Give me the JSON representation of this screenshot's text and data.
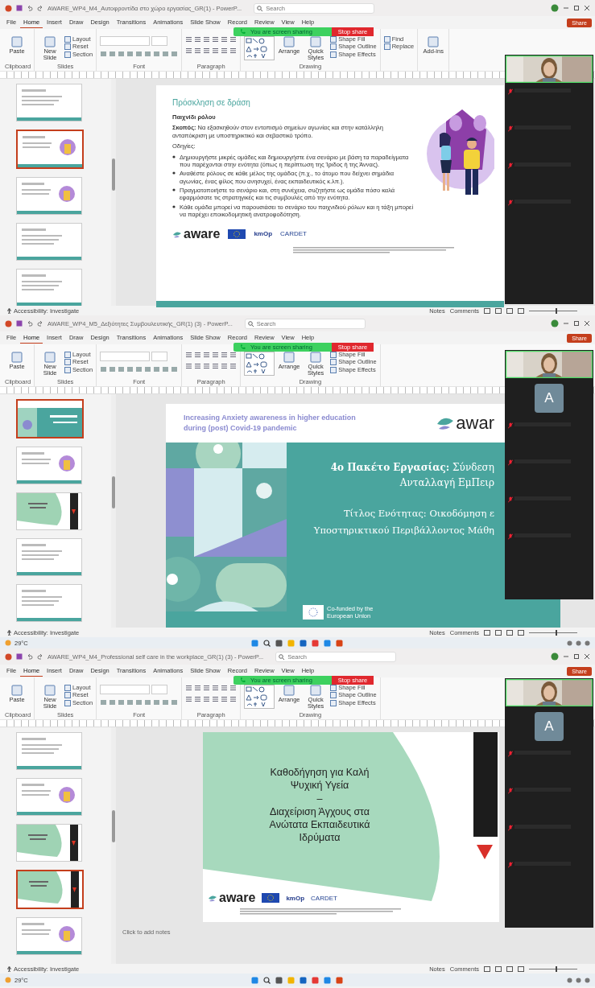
{
  "windows": [
    {
      "title": "AWARE_WP4_M4_Αυτοφροντίδα στο χώρο εργασίας_GR(1) - PowerP...",
      "search": {
        "placeholder": "Search"
      },
      "tabs": [
        {
          "label": "File",
          "selected": false
        },
        {
          "label": "Home",
          "selected": true
        },
        {
          "label": "Insert",
          "selected": false
        },
        {
          "label": "Draw",
          "selected": false
        },
        {
          "label": "Design",
          "selected": false
        },
        {
          "label": "Transitions",
          "selected": false
        },
        {
          "label": "Animations",
          "selected": false
        },
        {
          "label": "Slide Show",
          "selected": false
        },
        {
          "label": "Record",
          "selected": false
        },
        {
          "label": "Review",
          "selected": false
        },
        {
          "label": "View",
          "selected": false
        },
        {
          "label": "Help",
          "selected": false
        }
      ],
      "share_button": "Share",
      "share_banner": {
        "text": "You are screen sharing",
        "stop": "Stop share"
      },
      "ribbon": [
        {
          "label": "Clipboard",
          "items": [
            {
              "kind": "big",
              "label": "Paste"
            }
          ]
        },
        {
          "label": "Slides",
          "items": [
            {
              "kind": "big",
              "label": "New Slide"
            },
            {
              "kind": "small",
              "label": "Layout"
            },
            {
              "kind": "small",
              "label": "Reset"
            },
            {
              "kind": "small",
              "label": "Section"
            }
          ]
        },
        {
          "label": "Font",
          "items": [
            {
              "kind": "font"
            }
          ]
        },
        {
          "label": "Paragraph",
          "items": [
            {
              "kind": "paragraph"
            }
          ]
        },
        {
          "label": "Drawing",
          "items": [
            {
              "kind": "shapes"
            },
            {
              "kind": "big",
              "label": "Arrange"
            },
            {
              "kind": "big",
              "label": "Quick Styles"
            },
            {
              "kind": "small",
              "label": "Shape Fill"
            },
            {
              "kind": "small",
              "label": "Shape Outline"
            },
            {
              "kind": "small",
              "label": "Shape Effects"
            }
          ]
        },
        {
          "items": [
            {
              "kind": "small",
              "label": "Find"
            },
            {
              "kind": "small",
              "label": "Replace"
            }
          ]
        },
        {
          "items": [
            {
              "kind": "big",
              "label": "Add-ins"
            }
          ]
        }
      ],
      "thumbnails": [
        {
          "kind": "text",
          "selected": false
        },
        {
          "kind": "art",
          "selected": true
        },
        {
          "kind": "art",
          "selected": false
        },
        {
          "kind": "text",
          "selected": false
        },
        {
          "kind": "text",
          "selected": false
        }
      ],
      "slide": {
        "kind": "call_to_action",
        "title": "Πρόσκληση σε δράση",
        "subtitle": "Παιχνίδι ρόλου",
        "purpose": "**Σκοπός:** Να εξασκηθούν στον εντοπισμό σημείων αγωνίας και στην κατάλληλη ανταπόκριση με υποστηρικτικό και σεβαστικό τρόπο.",
        "instructions_label": "Οδηγίες:",
        "bullets": [
          "Δημιουργήστε μικρές ομάδες και δημιουργήστε ένα σενάριο με βάση τα παραδείγματα που παρέχονται στην ενότητα (όπως η περίπτωση της Ίριδος ή της Άννας).",
          "Αναθέστε ρόλους σε κάθε μέλος της ομάδας (π.χ., το άτομο που δείχνει σημάδια αγωνίας, ένας φίλος που ανησυχεί, ένας εκπαιδευτικός κ.λπ.).",
          "Πραγματοποιήστε το σενάριο και, στη συνέχεια, συζητήστε ως ομάδα πόσο καλά εφαρμόσατε τις στρατηγικές και τις συμβουλές από την ενότητα.",
          "Κάθε ομάδα μπορεί να παρουσιάσει το σενάριο του παιχνιδιού ρόλων και η τάξη μπορεί να παρέχει εποικοδομητική ανατροφοδότηση."
        ],
        "logos": [
          "aware",
          "kmOp",
          "CARDET"
        ]
      },
      "participants": [
        {
          "kind": "camera"
        },
        {
          "kind": "muted"
        },
        {
          "kind": "muted"
        },
        {
          "kind": "muted"
        },
        {
          "kind": "muted"
        }
      ],
      "status": {
        "accessibility": "Accessibility: Investigate",
        "notes": "Notes",
        "comments": "Comments",
        "zoom": {
          "level": 0.55
        }
      }
    },
    {
      "title": "AWARE_WP4_M5_Δεξιότητες Συμβουλευτικής_GR(1) (3) - PowerP...",
      "search": {
        "placeholder": "Search"
      },
      "tabs": [
        {
          "label": "File",
          "selected": false
        },
        {
          "label": "Home",
          "selected": true
        },
        {
          "label": "Insert",
          "selected": false
        },
        {
          "label": "Draw",
          "selected": false
        },
        {
          "label": "Design",
          "selected": false
        },
        {
          "label": "Transitions",
          "selected": false
        },
        {
          "label": "Animations",
          "selected": false
        },
        {
          "label": "Slide Show",
          "selected": false
        },
        {
          "label": "Record",
          "selected": false
        },
        {
          "label": "Review",
          "selected": false
        },
        {
          "label": "View",
          "selected": false
        },
        {
          "label": "Help",
          "selected": false
        }
      ],
      "share_button": "Share",
      "share_banner": {
        "text": "You are screen sharing",
        "stop": "Stop share"
      },
      "ribbon": [
        {
          "label": "Clipboard",
          "items": [
            {
              "kind": "big",
              "label": "Paste"
            }
          ]
        },
        {
          "label": "Slides",
          "items": [
            {
              "kind": "big",
              "label": "New Slide"
            },
            {
              "kind": "small",
              "label": "Layout"
            },
            {
              "kind": "small",
              "label": "Reset"
            },
            {
              "kind": "small",
              "label": "Section"
            }
          ]
        },
        {
          "label": "Font",
          "items": [
            {
              "kind": "font"
            }
          ]
        },
        {
          "label": "Paragraph",
          "items": [
            {
              "kind": "paragraph"
            }
          ]
        },
        {
          "label": "Drawing",
          "items": [
            {
              "kind": "shapes"
            },
            {
              "kind": "big",
              "label": "Arrange"
            },
            {
              "kind": "big",
              "label": "Quick Styles"
            },
            {
              "kind": "small",
              "label": "Shape Fill"
            },
            {
              "kind": "small",
              "label": "Shape Outline"
            },
            {
              "kind": "small",
              "label": "Shape Effects"
            }
          ]
        }
      ],
      "thumbnails": [
        {
          "kind": "teal",
          "selected": true
        },
        {
          "kind": "art",
          "selected": false
        },
        {
          "kind": "green",
          "selected": false
        },
        {
          "kind": "text",
          "selected": false
        },
        {
          "kind": "text",
          "selected": false
        }
      ],
      "slide": {
        "kind": "title_teal",
        "header_title": "Increasing Anxiety awareness in higher education during (post) Covid-19 pandemic",
        "logo": "awar",
        "heading_lines": [
          "**4ο Πακέτο Εργασίας:** Σύνδεση",
          "Ανταλλαγή ΕμΠειρ"
        ],
        "subtitle_lines": [
          "Τίτλος Ενότητας: Οικοδόμηση ε",
          "Υποστηρικτικού Περιβάλλοντος Μάθη"
        ],
        "eu_label": "Co-funded by the European Union"
      },
      "participants": [
        {
          "kind": "camera"
        },
        {
          "kind": "avatar",
          "initial": "A"
        },
        {
          "kind": "muted"
        },
        {
          "kind": "muted"
        },
        {
          "kind": "muted"
        },
        {
          "kind": "muted"
        }
      ],
      "status": {
        "accessibility": "Accessibility: Investigate",
        "notes": "Notes",
        "comments": "Comments",
        "zoom": {
          "level": 0.55
        }
      }
    },
    {
      "title": "AWARE_WP4_M4_Professional self care in the workplace_GR(1) (3) - PowerP...",
      "search": {
        "placeholder": "Search"
      },
      "tabs": [
        {
          "label": "File",
          "selected": false
        },
        {
          "label": "Home",
          "selected": true
        },
        {
          "label": "Insert",
          "selected": false
        },
        {
          "label": "Draw",
          "selected": false
        },
        {
          "label": "Design",
          "selected": false
        },
        {
          "label": "Transitions",
          "selected": false
        },
        {
          "label": "Animations",
          "selected": false
        },
        {
          "label": "Slide Show",
          "selected": false
        },
        {
          "label": "Record",
          "selected": false
        },
        {
          "label": "Review",
          "selected": false
        },
        {
          "label": "View",
          "selected": false
        },
        {
          "label": "Help",
          "selected": false
        }
      ],
      "share_button": "Share",
      "share_banner": {
        "text": "You are screen sharing",
        "stop": "Stop share"
      },
      "ribbon": [
        {
          "label": "Clipboard",
          "items": [
            {
              "kind": "big",
              "label": "Paste"
            }
          ]
        },
        {
          "label": "Slides",
          "items": [
            {
              "kind": "big",
              "label": "New Slide"
            },
            {
              "kind": "small",
              "label": "Layout"
            },
            {
              "kind": "small",
              "label": "Reset"
            },
            {
              "kind": "small",
              "label": "Section"
            }
          ]
        },
        {
          "label": "Font",
          "items": [
            {
              "kind": "font"
            }
          ]
        },
        {
          "label": "Paragraph",
          "items": [
            {
              "kind": "paragraph"
            }
          ]
        },
        {
          "label": "Drawing",
          "items": [
            {
              "kind": "shapes"
            },
            {
              "kind": "big",
              "label": "Arrange"
            },
            {
              "kind": "big",
              "label": "Quick Styles"
            },
            {
              "kind": "small",
              "label": "Shape Fill"
            },
            {
              "kind": "small",
              "label": "Shape Outline"
            },
            {
              "kind": "small",
              "label": "Shape Effects"
            }
          ]
        }
      ],
      "thumbnails": [
        {
          "kind": "text",
          "selected": false
        },
        {
          "kind": "art",
          "selected": false
        },
        {
          "kind": "green",
          "selected": false
        },
        {
          "kind": "green",
          "selected": true
        },
        {
          "kind": "art",
          "selected": false
        }
      ],
      "slide": {
        "kind": "title_green",
        "title_lines": [
          "Καθοδήγηση για Καλή",
          "Ψυχική Υγεία",
          "–",
          "Διαχείριση Άγχους στα",
          "Ανώτατα Εκπαιδευτικά",
          "Ιδρύματα"
        ],
        "logos": [
          "aware",
          "kmOp",
          "CARDET"
        ]
      },
      "notes_placeholder": "Click to add notes",
      "participants": [
        {
          "kind": "camera"
        },
        {
          "kind": "avatar",
          "initial": "A"
        },
        {
          "kind": "muted"
        },
        {
          "kind": "muted"
        },
        {
          "kind": "muted"
        },
        {
          "kind": "muted"
        }
      ],
      "status": {
        "accessibility": "Accessibility: Investigate",
        "notes": "Notes",
        "comments": "Comments",
        "zoom": {
          "level": 0.55
        }
      }
    }
  ],
  "taskbars": [
    {
      "weather": "29°C"
    },
    {
      "weather": "29°C"
    }
  ]
}
